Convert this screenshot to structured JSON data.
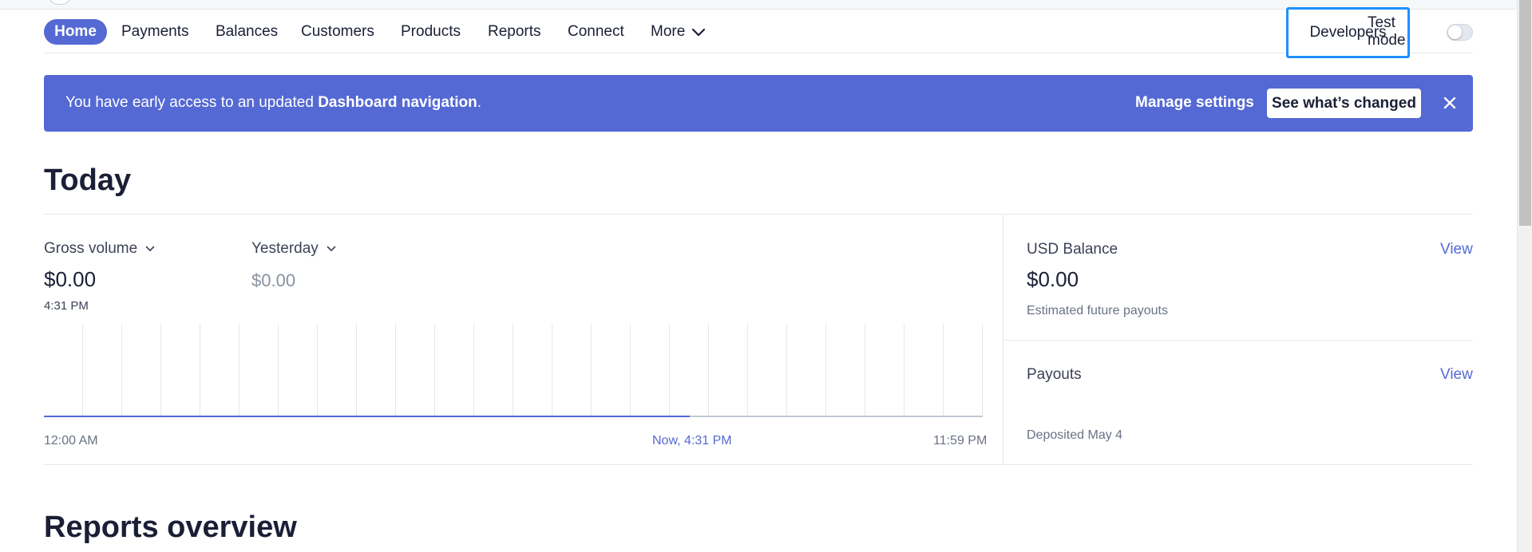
{
  "nav": {
    "items": [
      {
        "label": "Home"
      },
      {
        "label": "Payments"
      },
      {
        "label": "Balances"
      },
      {
        "label": "Customers"
      },
      {
        "label": "Products"
      },
      {
        "label": "Reports"
      },
      {
        "label": "Connect"
      },
      {
        "label": "More"
      }
    ],
    "developers": "Developers",
    "test_mode": "Test mode",
    "test_mode_on": false,
    "active_color": "#5469d4",
    "focus_outline_color": "#1e90ff"
  },
  "banner": {
    "text_before": "You have early access to an updated ",
    "text_bold": "Dashboard navigation",
    "text_after": ".",
    "manage": "Manage settings",
    "changed": "See what’s changed",
    "color": "#5469d4"
  },
  "today": {
    "title": "Today",
    "metric": "Gross volume",
    "compare": "Yesterday",
    "value": "$0.00",
    "time": "4:31 PM",
    "compare_value": "$0.00",
    "axis": {
      "start": "12:00 AM",
      "now": "Now, 4:31 PM",
      "end": "11:59 PM"
    },
    "progress_fraction": 0.688
  },
  "balance": {
    "title": "USD Balance",
    "view": "View",
    "value": "$0.00",
    "sub": "Estimated future payouts"
  },
  "payouts": {
    "title": "Payouts",
    "view": "View",
    "sub": "Deposited May 4"
  },
  "reports": {
    "title": "Reports overview"
  }
}
